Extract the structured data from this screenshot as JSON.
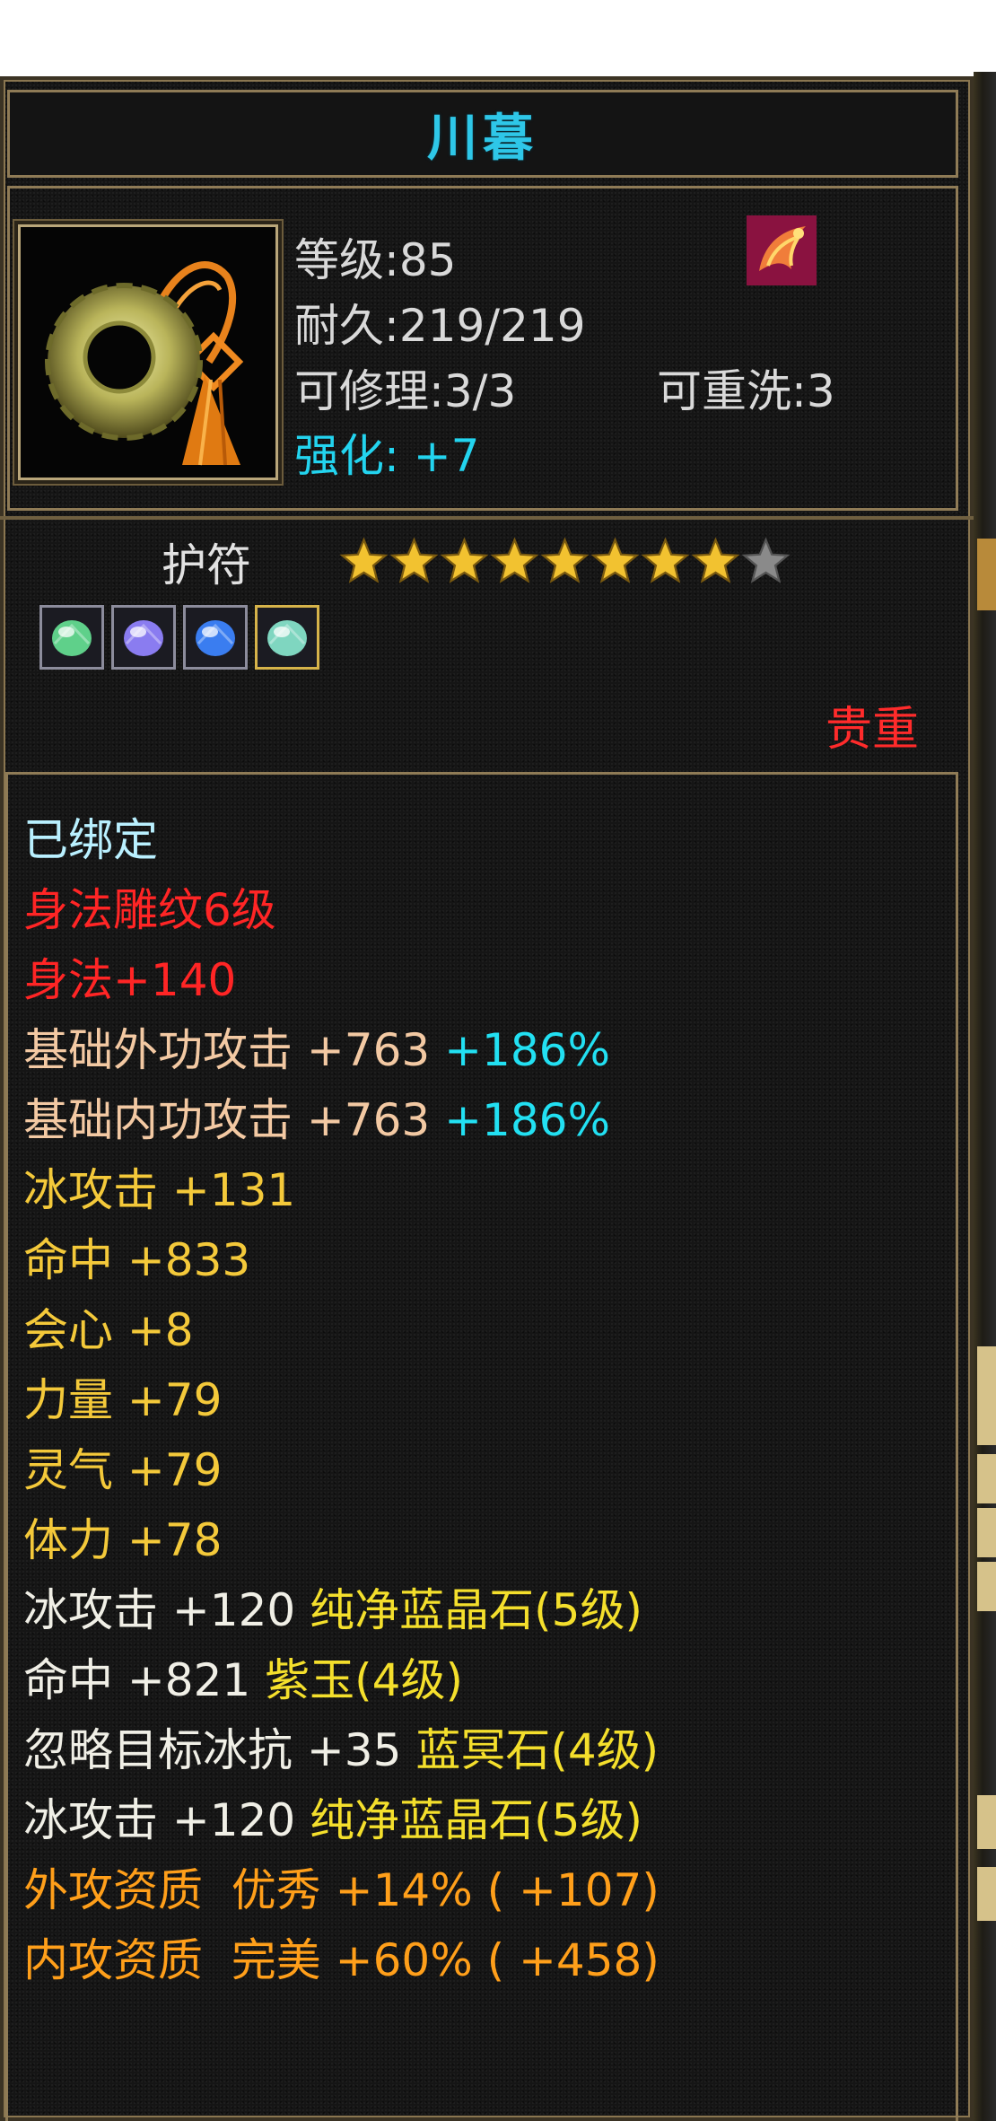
{
  "item": {
    "name": "川暮",
    "level": "等级:85",
    "durability": "耐久:219/219",
    "repairable": "可修理:3/3",
    "rewashable": "可重洗:3",
    "enhance": "强化: +7"
  },
  "category": {
    "label": "护符",
    "stars_total": 9,
    "stars_filled": 8
  },
  "gems": [
    {
      "icon": "green-crystal-gem-icon",
      "color": "#5fd08a"
    },
    {
      "icon": "purple-crystal-gem-icon",
      "color": "#8a7cf0"
    },
    {
      "icon": "blue-crystal-gem-icon",
      "color": "#3a7df0"
    },
    {
      "icon": "green-crystal-gem-icon",
      "color": "#7fd6c0"
    }
  ],
  "rarity": "贵重",
  "attributes": [
    {
      "text": "已绑定",
      "color": "bound"
    },
    {
      "text": "身法雕纹6级",
      "color": "red"
    },
    {
      "text": "身法+140",
      "color": "red"
    },
    {
      "text": "基础外功攻击 +763",
      "color": "peach",
      "extra": " +186%"
    },
    {
      "text": "基础内功攻击 +763",
      "color": "peach",
      "extra": " +186%"
    },
    {
      "text": "冰攻击 +131",
      "color": "yellow"
    },
    {
      "text": "命中 +833",
      "color": "yellow"
    },
    {
      "text": "会心 +8",
      "color": "yellow"
    },
    {
      "text": "力量 +79",
      "color": "yellow"
    },
    {
      "text": "灵气 +79",
      "color": "yellow"
    },
    {
      "text": "体力 +78",
      "color": "yellow"
    },
    {
      "text": "冰攻击 +120",
      "color": "white",
      "gem": " 纯净蓝晶石(5级)"
    },
    {
      "text": "命中 +821",
      "color": "white",
      "gem": " 紫玉(4级)"
    },
    {
      "text": "忽略目标冰抗 +35",
      "color": "white",
      "gem": " 蓝冥石(4级)"
    },
    {
      "text": "冰攻击 +120",
      "color": "white",
      "gem": " 纯净蓝晶石(5级)"
    },
    {
      "text": "外攻资质  优秀 +14% ( +107)",
      "color": "orange"
    },
    {
      "text": "内攻资质  完美 +60% ( +458)",
      "color": "orange"
    }
  ],
  "colors": {
    "title": "#2ec7e8",
    "accent_border": "#8f7b56",
    "rarity": "#ff2b2b",
    "star_filled": "#f2c230",
    "star_empty": "#8a8a8a"
  }
}
